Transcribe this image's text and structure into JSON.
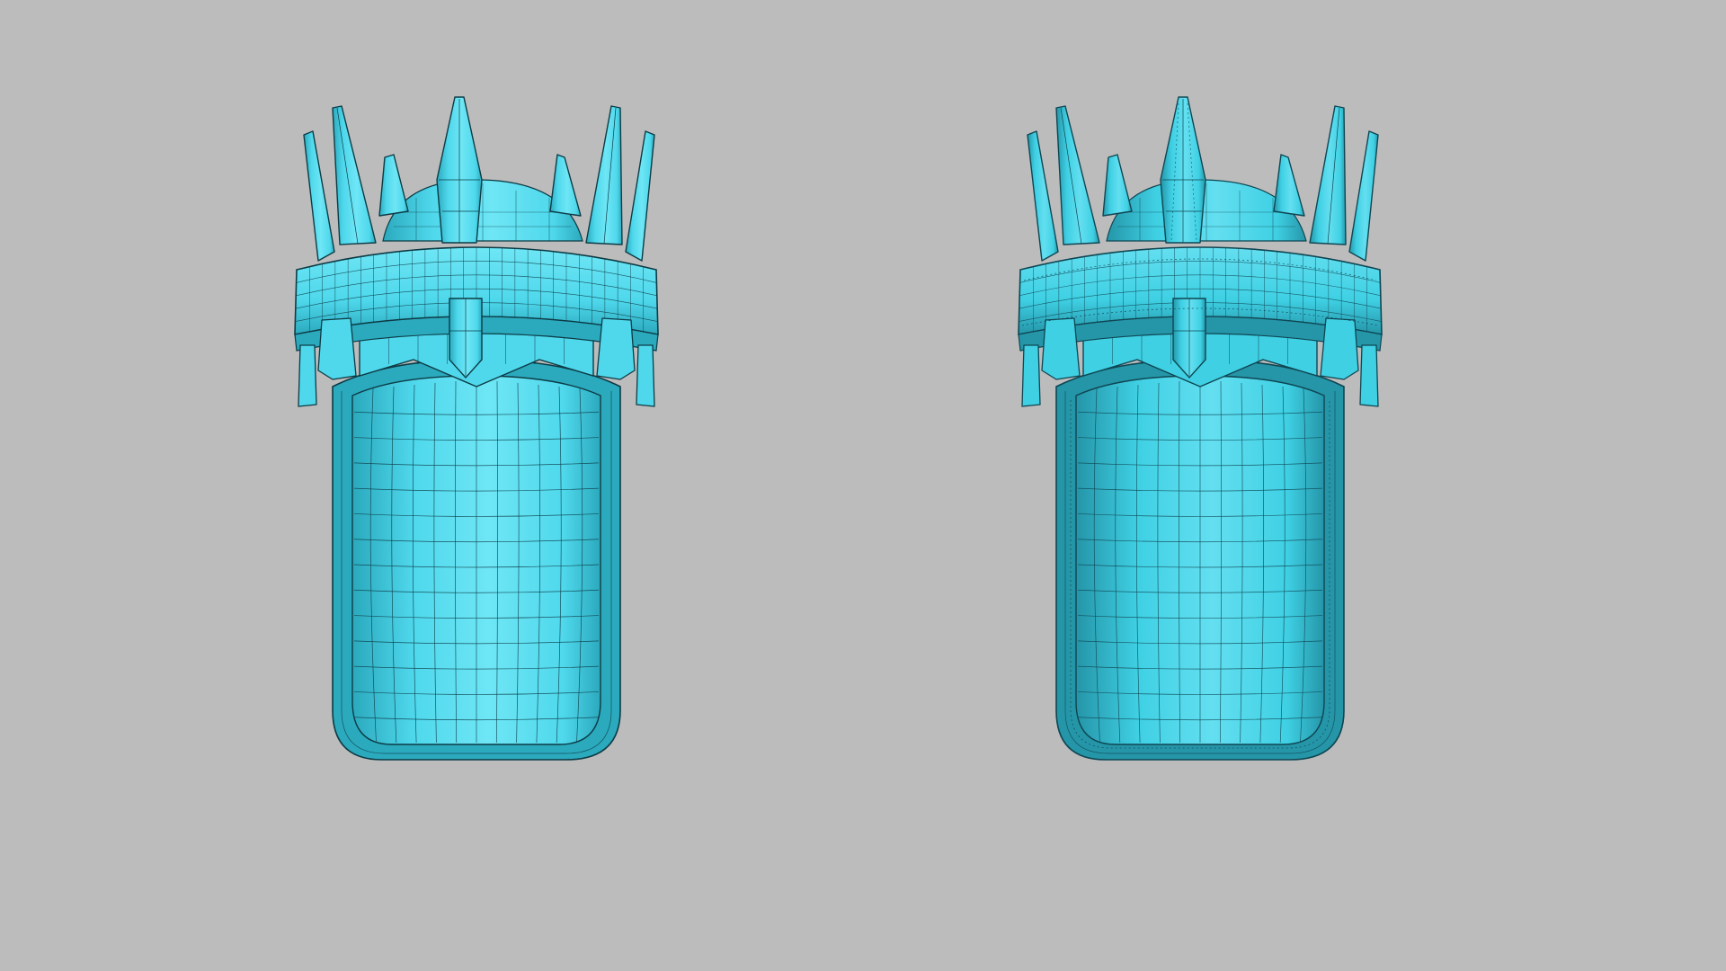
{
  "viewport": {
    "background_color": "#bcbcbc"
  },
  "models": [
    {
      "id": "low-poly",
      "base_color": "#4fd8ec",
      "shadow_color": "#2ba9bd",
      "highlight_color": "#6ee6f5",
      "wire_color": "#0d3b45",
      "surface_detail": false
    },
    {
      "id": "high-poly",
      "base_color": "#3fd0e4",
      "shadow_color": "#2595a8",
      "highlight_color": "#63dff0",
      "wire_color": "#0f4652",
      "surface_detail": true
    }
  ]
}
